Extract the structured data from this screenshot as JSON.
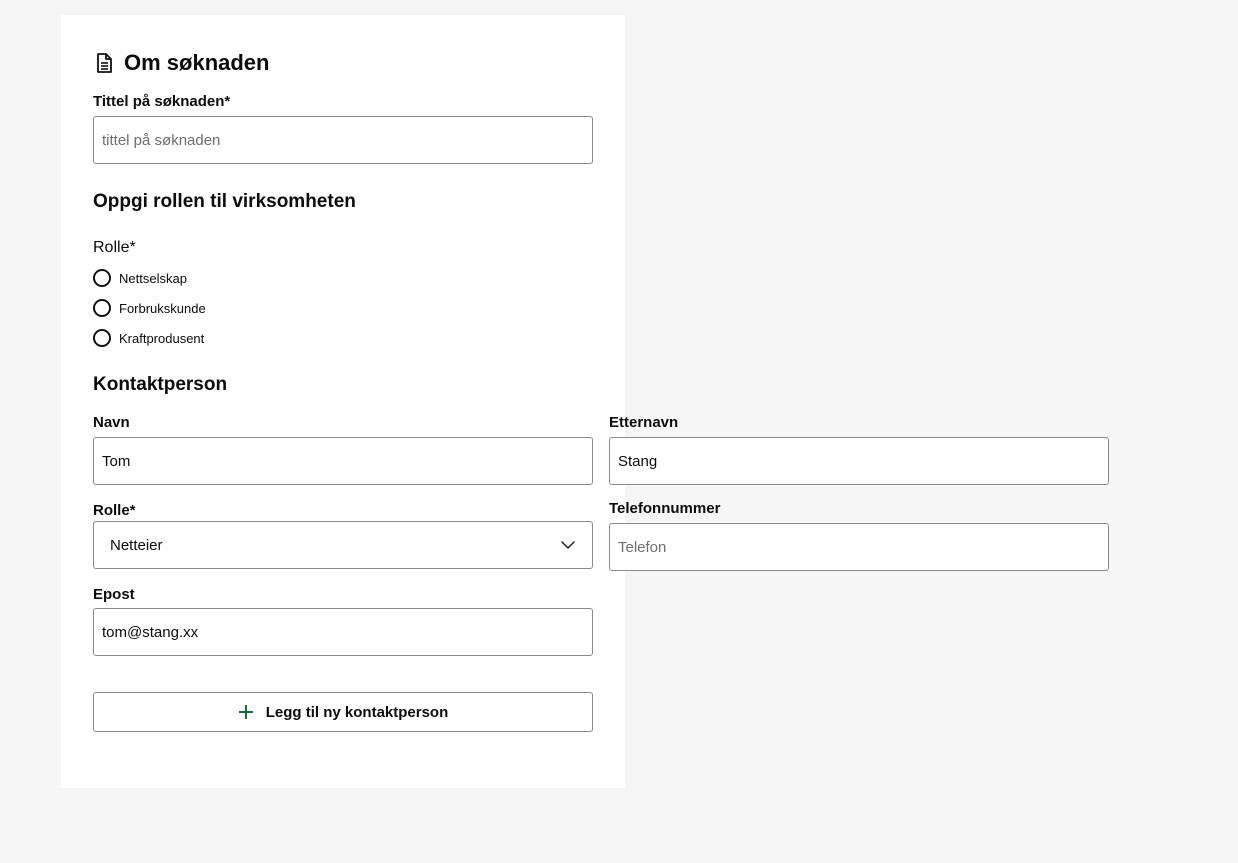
{
  "header": {
    "title": "Om søknaden",
    "icon": "document-icon"
  },
  "application": {
    "title_label": "Tittel på søknaden*",
    "title_placeholder": "tittel på søknaden",
    "title_value": ""
  },
  "role_section": {
    "heading": "Oppgi rollen til virksomheten",
    "group_label": "Rolle*",
    "options": [
      "Nettselskap",
      "Forbrukskunde",
      "Kraftprodusent"
    ]
  },
  "contact": {
    "heading": "Kontaktperson",
    "first_name_label": "Navn",
    "first_name_value": "Tom",
    "last_name_label": "Etternavn",
    "last_name_value": "Stang",
    "role_label": "Rolle*",
    "role_value": "Netteier",
    "phone_label": "Telefonnummer",
    "phone_placeholder": "Telefon",
    "phone_value": "",
    "email_label": "Epost",
    "email_value": "tom@stang.xx",
    "add_button_label": "Legg til ny kontaktperson"
  },
  "colors": {
    "background": "#f6f6f6",
    "card": "#ffffff",
    "border": "#8a8a8a",
    "accent_plus": "#1b6b3a"
  }
}
